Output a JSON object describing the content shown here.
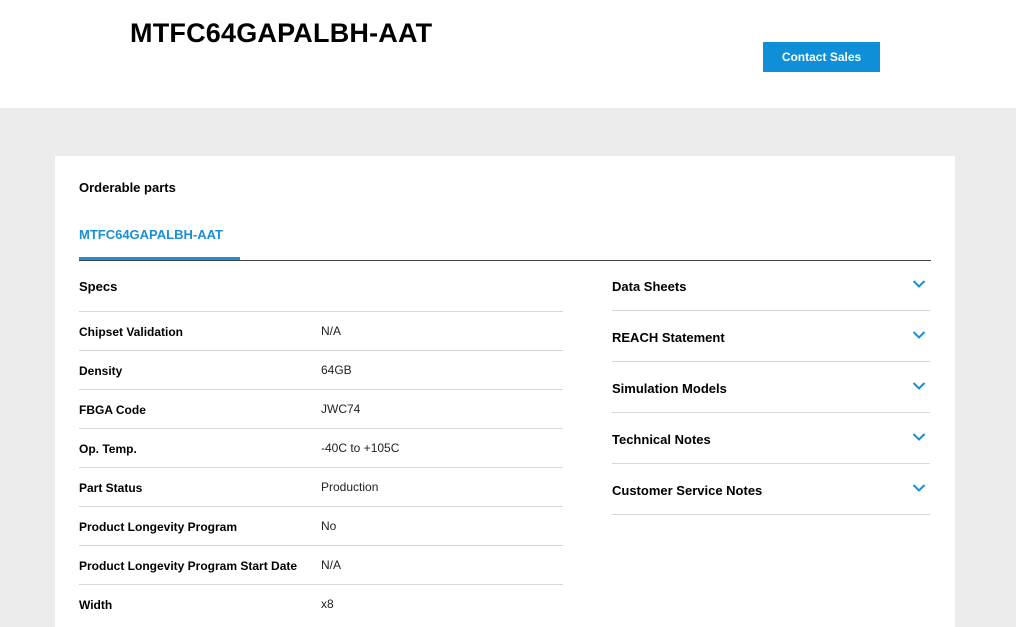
{
  "header": {
    "title": "MTFC64GAPALBH-AAT",
    "contact_button": "Contact Sales"
  },
  "card": {
    "heading": "Orderable parts",
    "tabs": [
      {
        "label": "MTFC64GAPALBH-AAT",
        "active": true
      }
    ]
  },
  "specs": {
    "heading": "Specs",
    "rows": [
      {
        "label": "Chipset Validation",
        "value": "N/A"
      },
      {
        "label": "Density",
        "value": "64GB"
      },
      {
        "label": "FBGA Code",
        "value": "JWC74"
      },
      {
        "label": "Op. Temp.",
        "value": "-40C to +105C"
      },
      {
        "label": "Part Status",
        "value": "Production"
      },
      {
        "label": "Product Longevity Program",
        "value": "No"
      },
      {
        "label": "Product Longevity Program Start Date",
        "value": "N/A"
      },
      {
        "label": "Width",
        "value": "x8"
      }
    ]
  },
  "documents": {
    "items": [
      {
        "label": "Data Sheets",
        "icon": "chevron-down-icon"
      },
      {
        "label": "REACH Statement",
        "icon": "chevron-down-icon"
      },
      {
        "label": "Simulation Models",
        "icon": "chevron-down-icon"
      },
      {
        "label": "Technical Notes",
        "icon": "chevron-down-icon"
      },
      {
        "label": "Customer Service Notes",
        "icon": "chevron-down-icon"
      }
    ]
  },
  "colors": {
    "accent": "#0f8fd8",
    "page_background": "#ececec"
  }
}
